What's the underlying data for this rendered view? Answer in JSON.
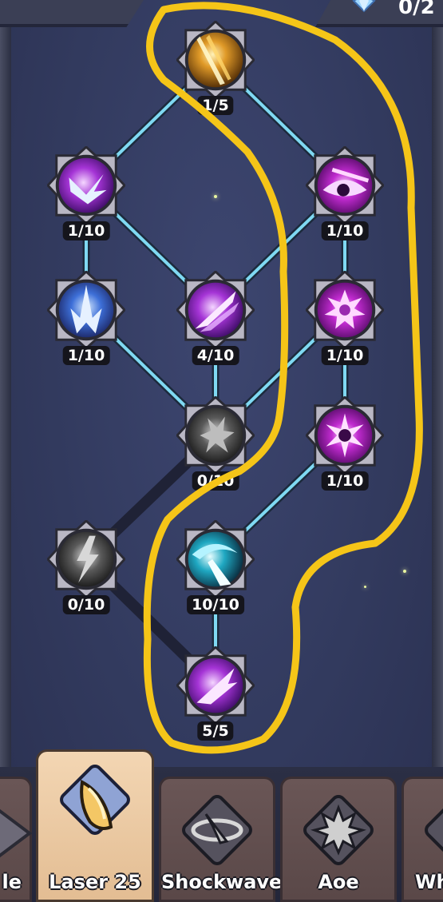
{
  "header": {
    "currency_value": "0/2",
    "currency_icon": "gem-icon"
  },
  "skill_tree": {
    "nodes": [
      {
        "id": "n-top",
        "level": "1/5",
        "art": "gold"
      },
      {
        "id": "n-l1",
        "level": "1/10",
        "art": "violet"
      },
      {
        "id": "n-r1",
        "level": "1/10",
        "art": "magenta"
      },
      {
        "id": "n-l2",
        "level": "1/10",
        "art": "blue"
      },
      {
        "id": "n-c2",
        "level": "4/10",
        "art": "violet"
      },
      {
        "id": "n-r2",
        "level": "1/10",
        "art": "magenta"
      },
      {
        "id": "n-c3",
        "level": "0/10",
        "art": "gray"
      },
      {
        "id": "n-r3",
        "level": "1/10",
        "art": "magenta"
      },
      {
        "id": "n-l4",
        "level": "0/10",
        "art": "gray"
      },
      {
        "id": "n-c4",
        "level": "10/10",
        "art": "cyan"
      },
      {
        "id": "n-c5",
        "level": "5/5",
        "art": "violet"
      }
    ],
    "link_color_active": "#7fd9f2",
    "link_color_inactive": "#1f2236",
    "highlight_color": "#f5c518"
  },
  "tabs": [
    {
      "label": "le",
      "active": false,
      "icon": "partial-icon"
    },
    {
      "label": "Laser 25",
      "active": true,
      "icon": "laser-icon"
    },
    {
      "label": "Shockwave",
      "active": false,
      "icon": "shockwave-icon"
    },
    {
      "label": "Aoe",
      "active": false,
      "icon": "explosion-icon"
    },
    {
      "label": "Wh",
      "active": false,
      "icon": "whirl-icon"
    }
  ]
}
